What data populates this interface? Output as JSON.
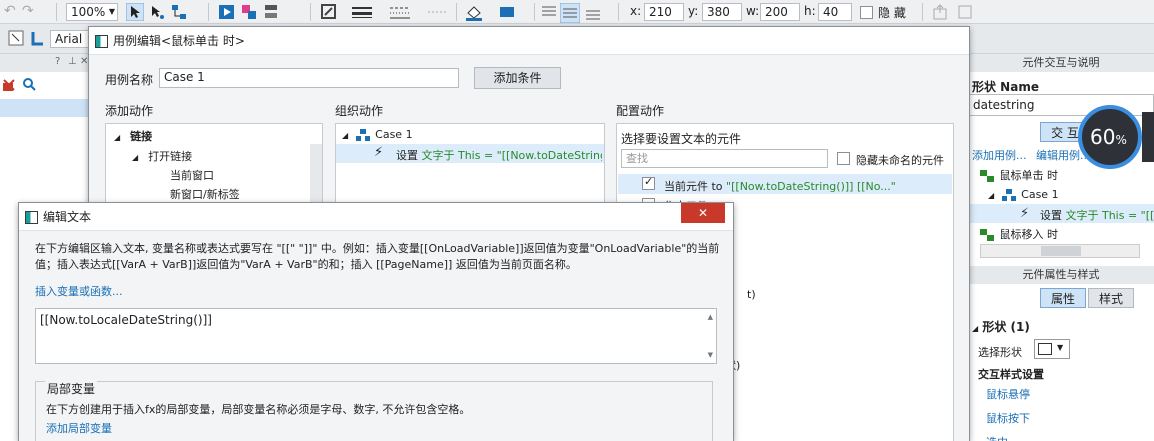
{
  "toolbar": {
    "zoom": "100%",
    "x_label": "x:",
    "x_value": "210",
    "y_label": "y:",
    "y_value": "380",
    "w_label": "w:",
    "w_value": "200",
    "h_label": "h:",
    "h_value": "40",
    "hide_label": "隐 藏",
    "font_name": "Arial"
  },
  "right_panel": {
    "header1": "元件交互与说明",
    "shape_name_label": "形状 Name",
    "shape_name_value": "datestring",
    "interaction_tab": "交 互",
    "add_case_link": "添加用例...",
    "edit_case_link": "编辑用例...",
    "event_click": "鼠标单击 时",
    "case1": "Case 1",
    "action_prefix": "设置",
    "action_text": "文字于 This = \"[[No",
    "event_mouseenter": "鼠标移入 时",
    "header2": "元件属性与样式",
    "props_tab": "属性",
    "style_tab": "样式",
    "shape_count": "形状 (1)",
    "select_shape": "选择形状",
    "interaction_style": "交互样式设置",
    "hover": "鼠标悬停",
    "mousedown": "鼠标按下",
    "selected": "选中",
    "progress": "60",
    "progress_unit": "%"
  },
  "case_editor": {
    "title": "用例编辑<鼠标单击 时>",
    "case_name_label": "用例名称",
    "case_name_value": "Case 1",
    "add_condition": "添加条件",
    "add_action_title": "添加动作",
    "organize_title": "组织动作",
    "config_title": "配置动作",
    "tree": {
      "links": "链接",
      "open_link": "打开链接",
      "current_window": "当前窗口",
      "new_window": "新窗口/新标签"
    },
    "organize": {
      "case": "Case 1",
      "action_prefix": "设置",
      "action_text": "文字于 This = \"[[Now.toDateString()]]"
    },
    "config": {
      "select_label": "选择要设置文本的元件",
      "search_placeholder": "查找",
      "hide_unnamed": "隐藏未命名的元件",
      "current_widget_prefix": "当前元件 to",
      "current_widget_value": "\"[[Now.toDateString()]] [[No...\"",
      "focus_widget": "焦点元件",
      "fragment1": "t)",
      "fragment2": "状)"
    }
  },
  "text_editor": {
    "title": "编辑文本",
    "instructions": "在下方编辑区输入文本, 变量名称或表达式要写在 \"[[\" \"]]\" 中。例如：插入变量[[OnLoadVariable]]返回值为变量\"OnLoadVariable\"的当前值；插入表达式[[VarA + VarB]]返回值为\"VarA + VarB\"的和；插入 [[PageName]] 返回值为当前页面名称。",
    "insert_link": "插入变量或函数...",
    "expression": "[[Now.toLocaleDateString()]]",
    "local_vars_title": "局部变量",
    "local_vars_desc": "在下方创建用于插入fx的局部变量，局部变量名称必须是字母、数字, 不允许包含空格。",
    "add_local_var": "添加局部变量",
    "close_label": "✕"
  }
}
